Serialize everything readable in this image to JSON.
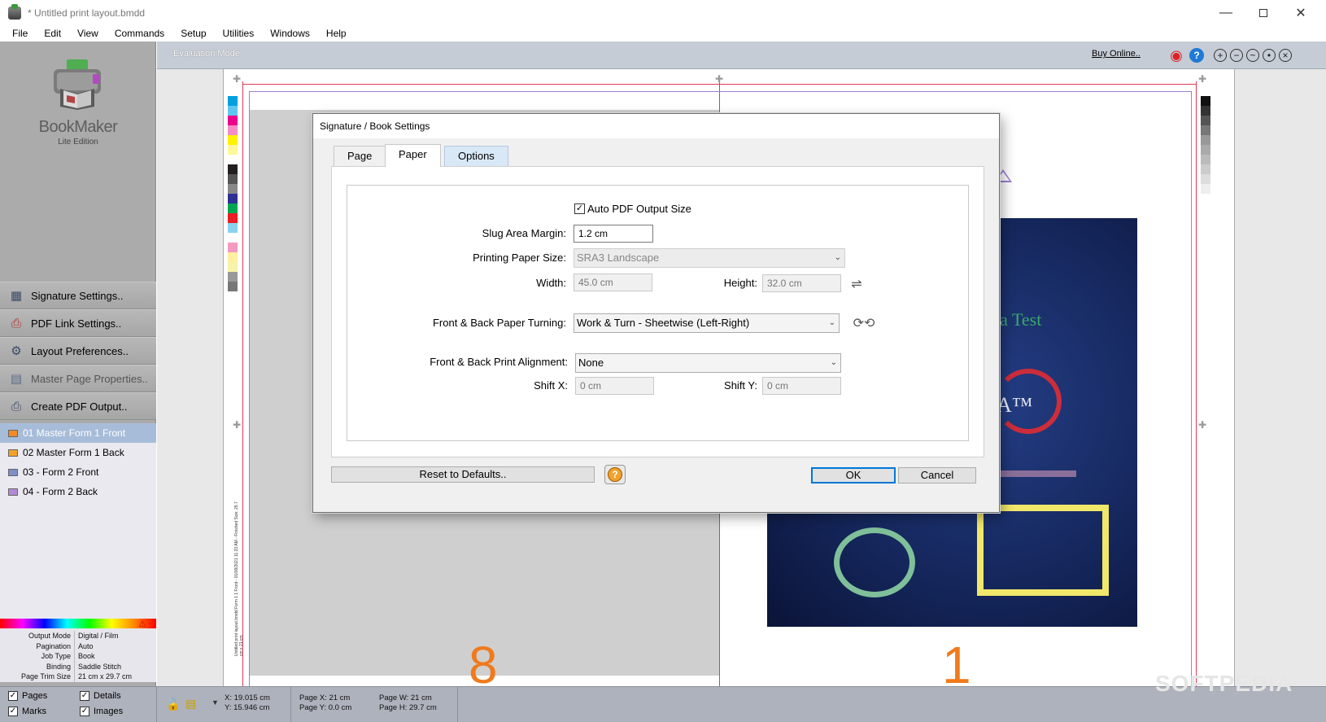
{
  "window": {
    "title": "* Untitled print layout.bmdd",
    "controls": [
      "minimize",
      "maximize",
      "close"
    ]
  },
  "menu": [
    "File",
    "Edit",
    "View",
    "Commands",
    "Setup",
    "Utilities",
    "Windows",
    "Help"
  ],
  "sidebar": {
    "logo_name": "BookMaker",
    "logo_sub": "Lite Edition",
    "buttons": [
      {
        "label": "Signature Settings..",
        "icon": "signature-grid-icon"
      },
      {
        "label": "PDF Link Settings..",
        "icon": "pdf-link-icon"
      },
      {
        "label": "Layout Preferences..",
        "icon": "gear-icon"
      },
      {
        "label": "Master Page Properties..",
        "icon": "master-page-icon"
      },
      {
        "label": "Create PDF Output..",
        "icon": "printer-icon"
      }
    ],
    "forms": [
      {
        "label": "01 Master Form 1 Front",
        "selected": true,
        "color": "#f28c28"
      },
      {
        "label": "02 Master Form 1 Back",
        "selected": false,
        "color": "#f2a12a"
      },
      {
        "label": "03 - Form 2 Front",
        "selected": false,
        "color": "#7d8ec9"
      },
      {
        "label": "04 - Form 2 Back",
        "selected": false,
        "color": "#b28ad4"
      }
    ],
    "properties": [
      {
        "key": "Output Mode",
        "value": "Digital / Film"
      },
      {
        "key": "Pagination",
        "value": "Auto"
      },
      {
        "key": "Job Type",
        "value": "Book"
      },
      {
        "key": "Binding",
        "value": "Saddle Stitch"
      },
      {
        "key": "Page Trim Size",
        "value": "21 cm x 29.7 cm"
      }
    ]
  },
  "statusbar": {
    "pages": "Pages",
    "details": "Details",
    "marks": "Marks",
    "images": "Images",
    "x": "X: 19.015 cm",
    "y": "Y: 15.946 cm",
    "page_x": "Page X: 21 cm",
    "page_y": "Page Y: 0.0 cm",
    "page_w": "Page W: 21 cm",
    "page_h": "Page H: 29.7 cm"
  },
  "canvas": {
    "eval_mode": "Evaluation Mode",
    "buy_online": "Buy Online..",
    "page_left": "8",
    "page_right": "1",
    "cover_title": "ia Test",
    "cover_letter": "A™",
    "watermark": "SOFTPEDIA",
    "slug_text": "Untitled print layout.bmdd Form 1 1 Front - 01/08/2021 11:23 AM - Finished Size: 29.7 cm x 21 cm",
    "colors": {
      "trim": "#e03a54",
      "bleed": "#9a7fd2",
      "page_number": "#f07a1c"
    }
  },
  "dialog": {
    "title": "Signature / Book Settings",
    "tabs": [
      "Page",
      "Paper",
      "Options"
    ],
    "active_tab": "Paper",
    "auto_pdf": {
      "label": "Auto PDF Output Size",
      "checked": true
    },
    "slug_margin": {
      "label": "Slug Area Margin:",
      "value": "1.2 cm"
    },
    "paper_size": {
      "label": "Printing Paper Size:",
      "value": "SRA3 Landscape"
    },
    "width": {
      "label": "Width:",
      "value": "45.0 cm"
    },
    "height": {
      "label": "Height:",
      "value": "32.0 cm"
    },
    "turning": {
      "label": "Front & Back Paper Turning:",
      "value": "Work & Turn - Sheetwise (Left-Right)"
    },
    "alignment": {
      "label": "Front & Back Print Alignment:",
      "value": "None"
    },
    "shift_x": {
      "label": "Shift X:",
      "value": "0 cm"
    },
    "shift_y": {
      "label": "Shift Y:",
      "value": "0 cm"
    },
    "reset_label": "Reset to Defaults..",
    "ok_label": "OK",
    "cancel_label": "Cancel"
  }
}
